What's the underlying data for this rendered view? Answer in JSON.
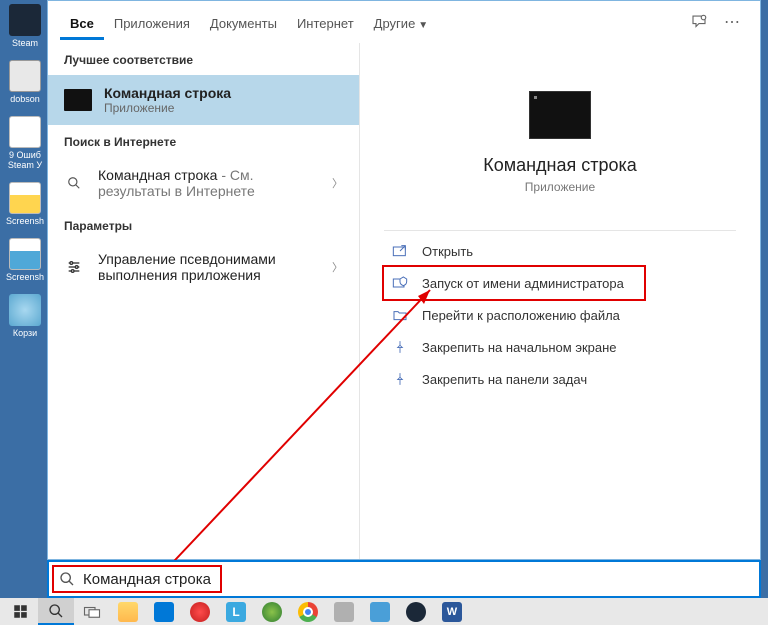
{
  "desktop": {
    "items": [
      {
        "label": "Steam"
      },
      {
        "label": "dobson"
      },
      {
        "label": "9 Ошиб\nSteam У"
      },
      {
        "label": "Screensh"
      },
      {
        "label": "Screensh"
      },
      {
        "label": "Корзи"
      }
    ]
  },
  "tabs": {
    "items": [
      "Все",
      "Приложения",
      "Документы",
      "Интернет",
      "Другие"
    ]
  },
  "left": {
    "best_match_label": "Лучшее соответствие",
    "best_match": {
      "title": "Командная строка",
      "subtitle": "Приложение"
    },
    "web_label": "Поиск в Интернете",
    "web_item": {
      "prefix": "Командная строка",
      "suffix": " - См. результаты в Интернете"
    },
    "settings_label": "Параметры",
    "settings_item": "Управление псевдонимами выполнения приложения"
  },
  "right": {
    "title": "Командная строка",
    "subtitle": "Приложение",
    "actions": [
      "Открыть",
      "Запуск от имени администратора",
      "Перейти к расположению файла",
      "Закрепить на начальном экране",
      "Закрепить на панели задач"
    ]
  },
  "search": {
    "value": "Командная строка"
  }
}
